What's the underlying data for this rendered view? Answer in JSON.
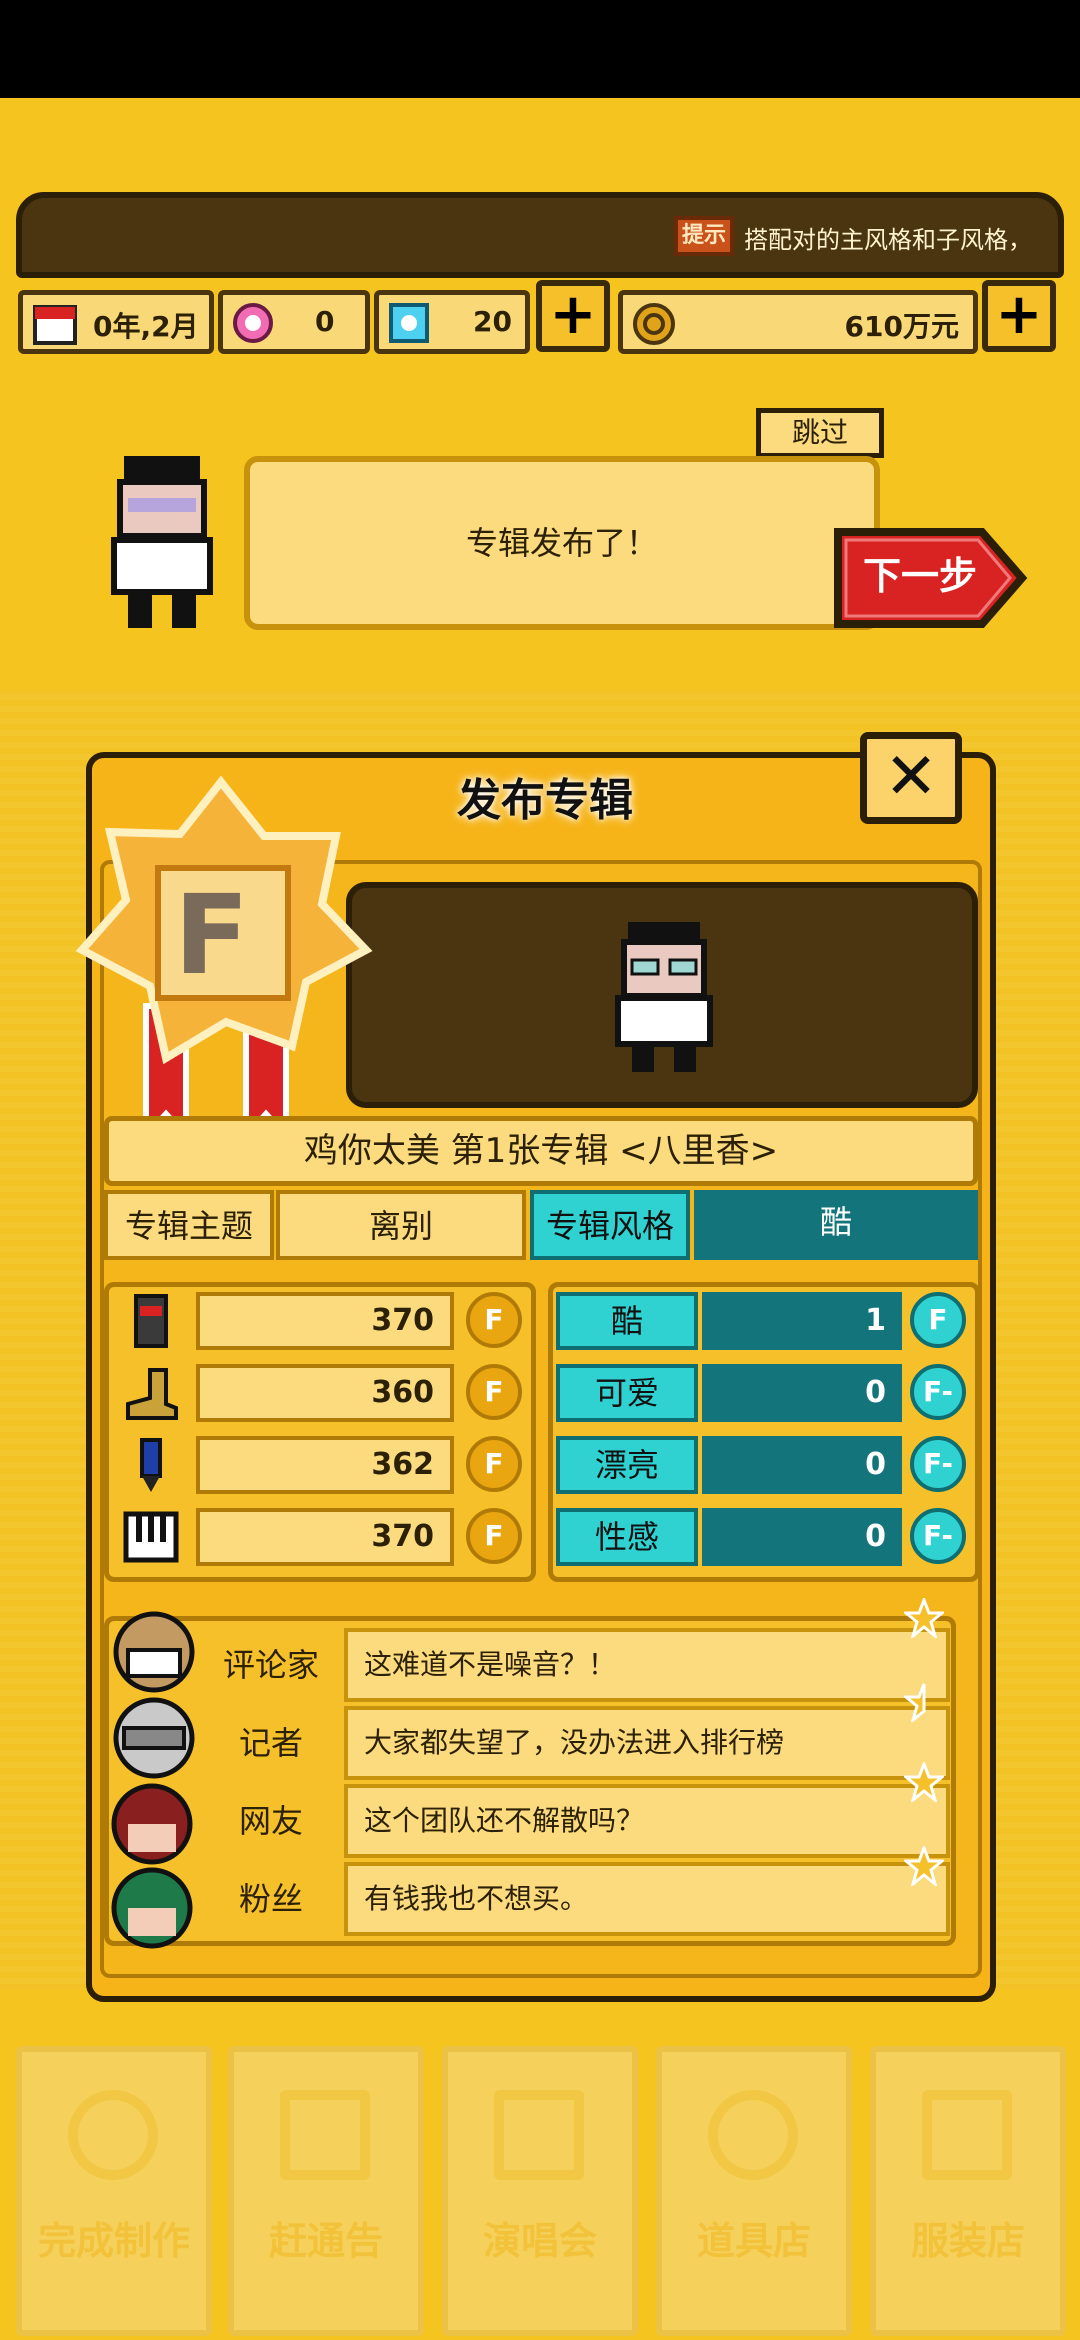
{
  "tip": {
    "badge": "提示",
    "text": "搭配对的主风格和子风格，"
  },
  "stats": {
    "date": "0年,2月",
    "pink_gems": "0",
    "blue_gems": "20",
    "money": "610万元"
  },
  "dialog": {
    "skip_label": "跳过",
    "speech": "专辑发布了！",
    "next_label": "下一步"
  },
  "modal": {
    "title": "发布专辑",
    "grade": "F",
    "album_title": "鸡你太美 第1张专辑 <八里香>",
    "theme_label": "专辑主题",
    "theme_value": "离别",
    "style_label": "专辑风格",
    "style_value": "酷",
    "left_stats": [
      {
        "icon": "microphone-icon",
        "value": "370",
        "grade": "F"
      },
      {
        "icon": "boot-icon",
        "value": "360",
        "grade": "F"
      },
      {
        "icon": "pen-icon",
        "value": "362",
        "grade": "F"
      },
      {
        "icon": "piano-icon",
        "value": "370",
        "grade": "F"
      }
    ],
    "right_stats": [
      {
        "label": "酷",
        "value": "1",
        "grade": "F"
      },
      {
        "label": "可爱",
        "value": "0",
        "grade": "F-"
      },
      {
        "label": "漂亮",
        "value": "0",
        "grade": "F-"
      },
      {
        "label": "性感",
        "value": "0",
        "grade": "F-"
      }
    ],
    "reviews": [
      {
        "name": "评论家",
        "text": "这难道不是噪音？！",
        "stars": 0.0
      },
      {
        "name": "记者",
        "text": "大家都失望了，没办法进入排行榜",
        "stars": 0.5
      },
      {
        "name": "网友",
        "text": "这个团队还不解散吗？",
        "stars": 0.0
      },
      {
        "name": "粉丝",
        "text": "有钱我也不想买。",
        "stars": 0.0
      }
    ]
  },
  "bottom_nav": [
    "完成制作",
    "赶通告",
    "演唱会",
    "道具店",
    "服装店"
  ],
  "colors": {
    "background": "#f5c41f",
    "teal": "#13747b",
    "accent_red": "#d92323"
  }
}
